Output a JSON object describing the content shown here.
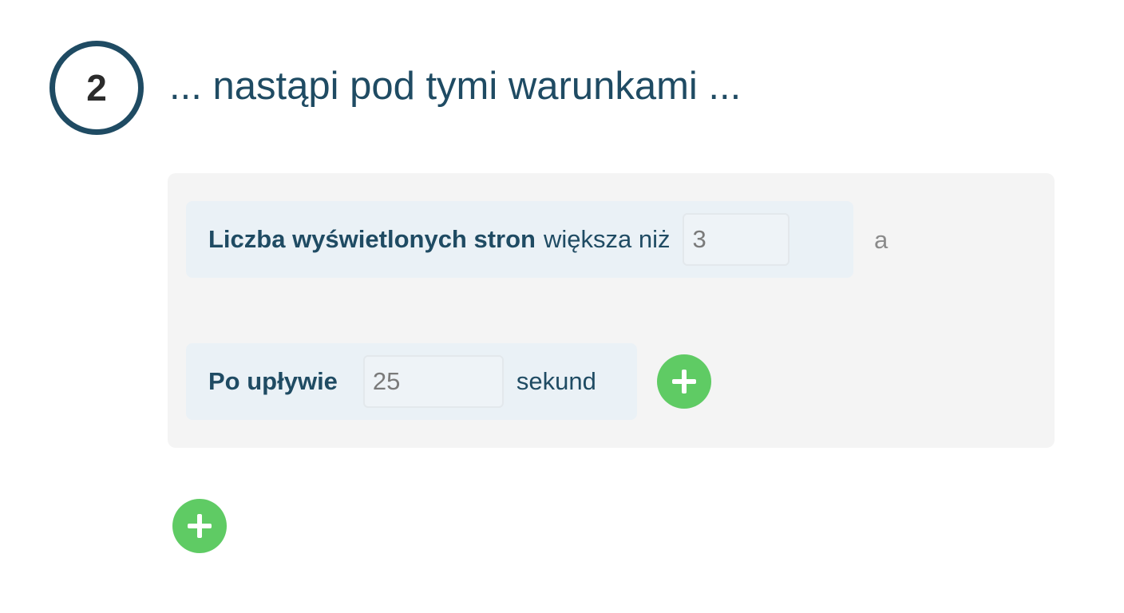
{
  "step": {
    "number": "2",
    "title": "... nastąpi pod tymi warunkami ..."
  },
  "conditions": {
    "page_views": {
      "label": "Liczba wyświetlonych stron",
      "operator": "większa niż",
      "value": "3"
    },
    "connector": "a",
    "time": {
      "label": "Po upływie",
      "value": "25",
      "unit": "sekund"
    }
  },
  "colors": {
    "accent": "#1f4b63",
    "add_button": "#5fcb64",
    "panel_bg": "#f4f4f4",
    "row_bg": "#eaf1f6"
  },
  "icons": {
    "add_condition": "plus-icon",
    "add_group": "plus-icon"
  }
}
